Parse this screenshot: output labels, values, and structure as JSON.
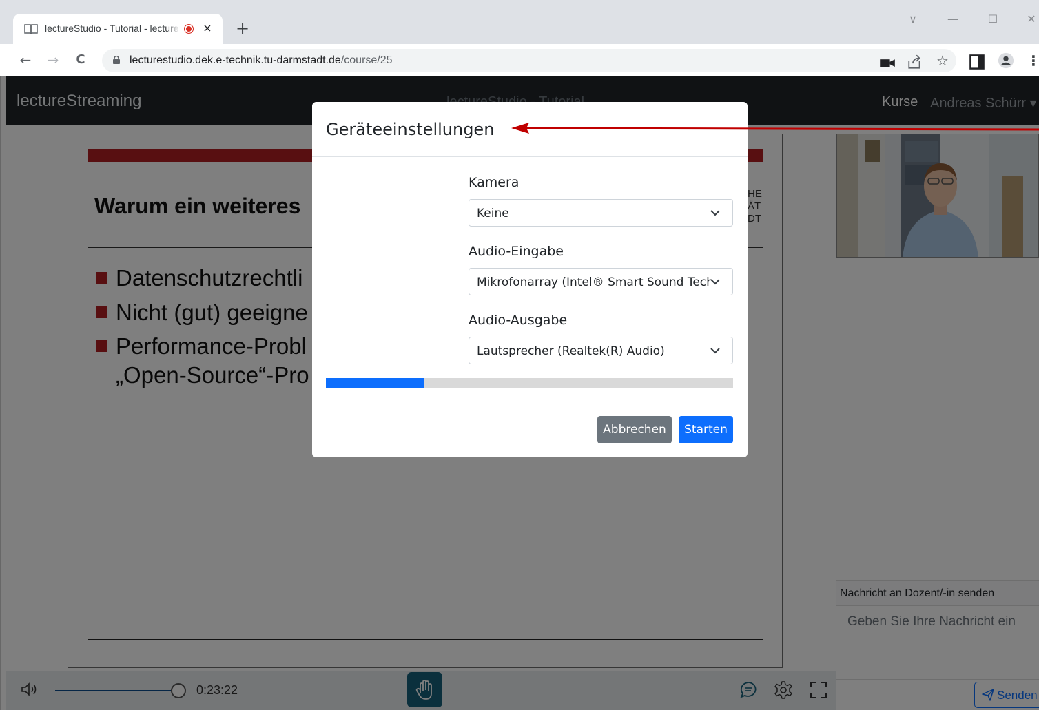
{
  "browser": {
    "tab_title": "lectureStudio - Tutorial - lectureStudio",
    "new_tab": "+",
    "tab_close": "×",
    "url_host": "lecturestudio.dek.e-technik.tu-darmstadt.de",
    "url_path": "/course/25",
    "back": "←",
    "forward": "→",
    "reload": "C",
    "win_dropdown": "∨",
    "win_minimize": "—",
    "win_maximize": "☐",
    "win_close": "✕",
    "star": "☆",
    "more": "⋮"
  },
  "app": {
    "brand": "lectureStreaming",
    "center_title": "lectureStudio - Tutorial",
    "nav_courses": "Kurse",
    "nav_user": "Andreas Schürr ▾"
  },
  "slide": {
    "title": "Warum ein weiteres",
    "logo_lines": [
      "HE",
      "ÄT",
      "DT"
    ],
    "bullets": [
      "Datenschutzrechtli",
      "Nicht (gut) geeigne",
      "Performance-Probl",
      "„Open-Source“-Pro"
    ]
  },
  "player": {
    "time": "0:23:22",
    "progress": 0.81
  },
  "chat": {
    "header": "Nachricht an Dozent/-in senden",
    "placeholder": "Geben Sie Ihre Nachricht ein",
    "send_label": "Senden"
  },
  "modal": {
    "title": "Geräteeinstellungen",
    "camera_label": "Kamera",
    "camera_value": "Keine",
    "audio_in_label": "Audio-Eingabe",
    "audio_in_value": "Mikrofonarray (Intel® Smart Sound Technologie)",
    "audio_out_label": "Audio-Ausgabe",
    "audio_out_value": "Lautsprecher (Realtek(R) Audio)",
    "level": 0.24,
    "cancel_label": "Abbrechen",
    "start_label": "Starten"
  },
  "colors": {
    "accent": "#0d6efd",
    "annotation_arrow": "#c00000",
    "slide_red": "#b01e23",
    "appbar": "#212529"
  }
}
